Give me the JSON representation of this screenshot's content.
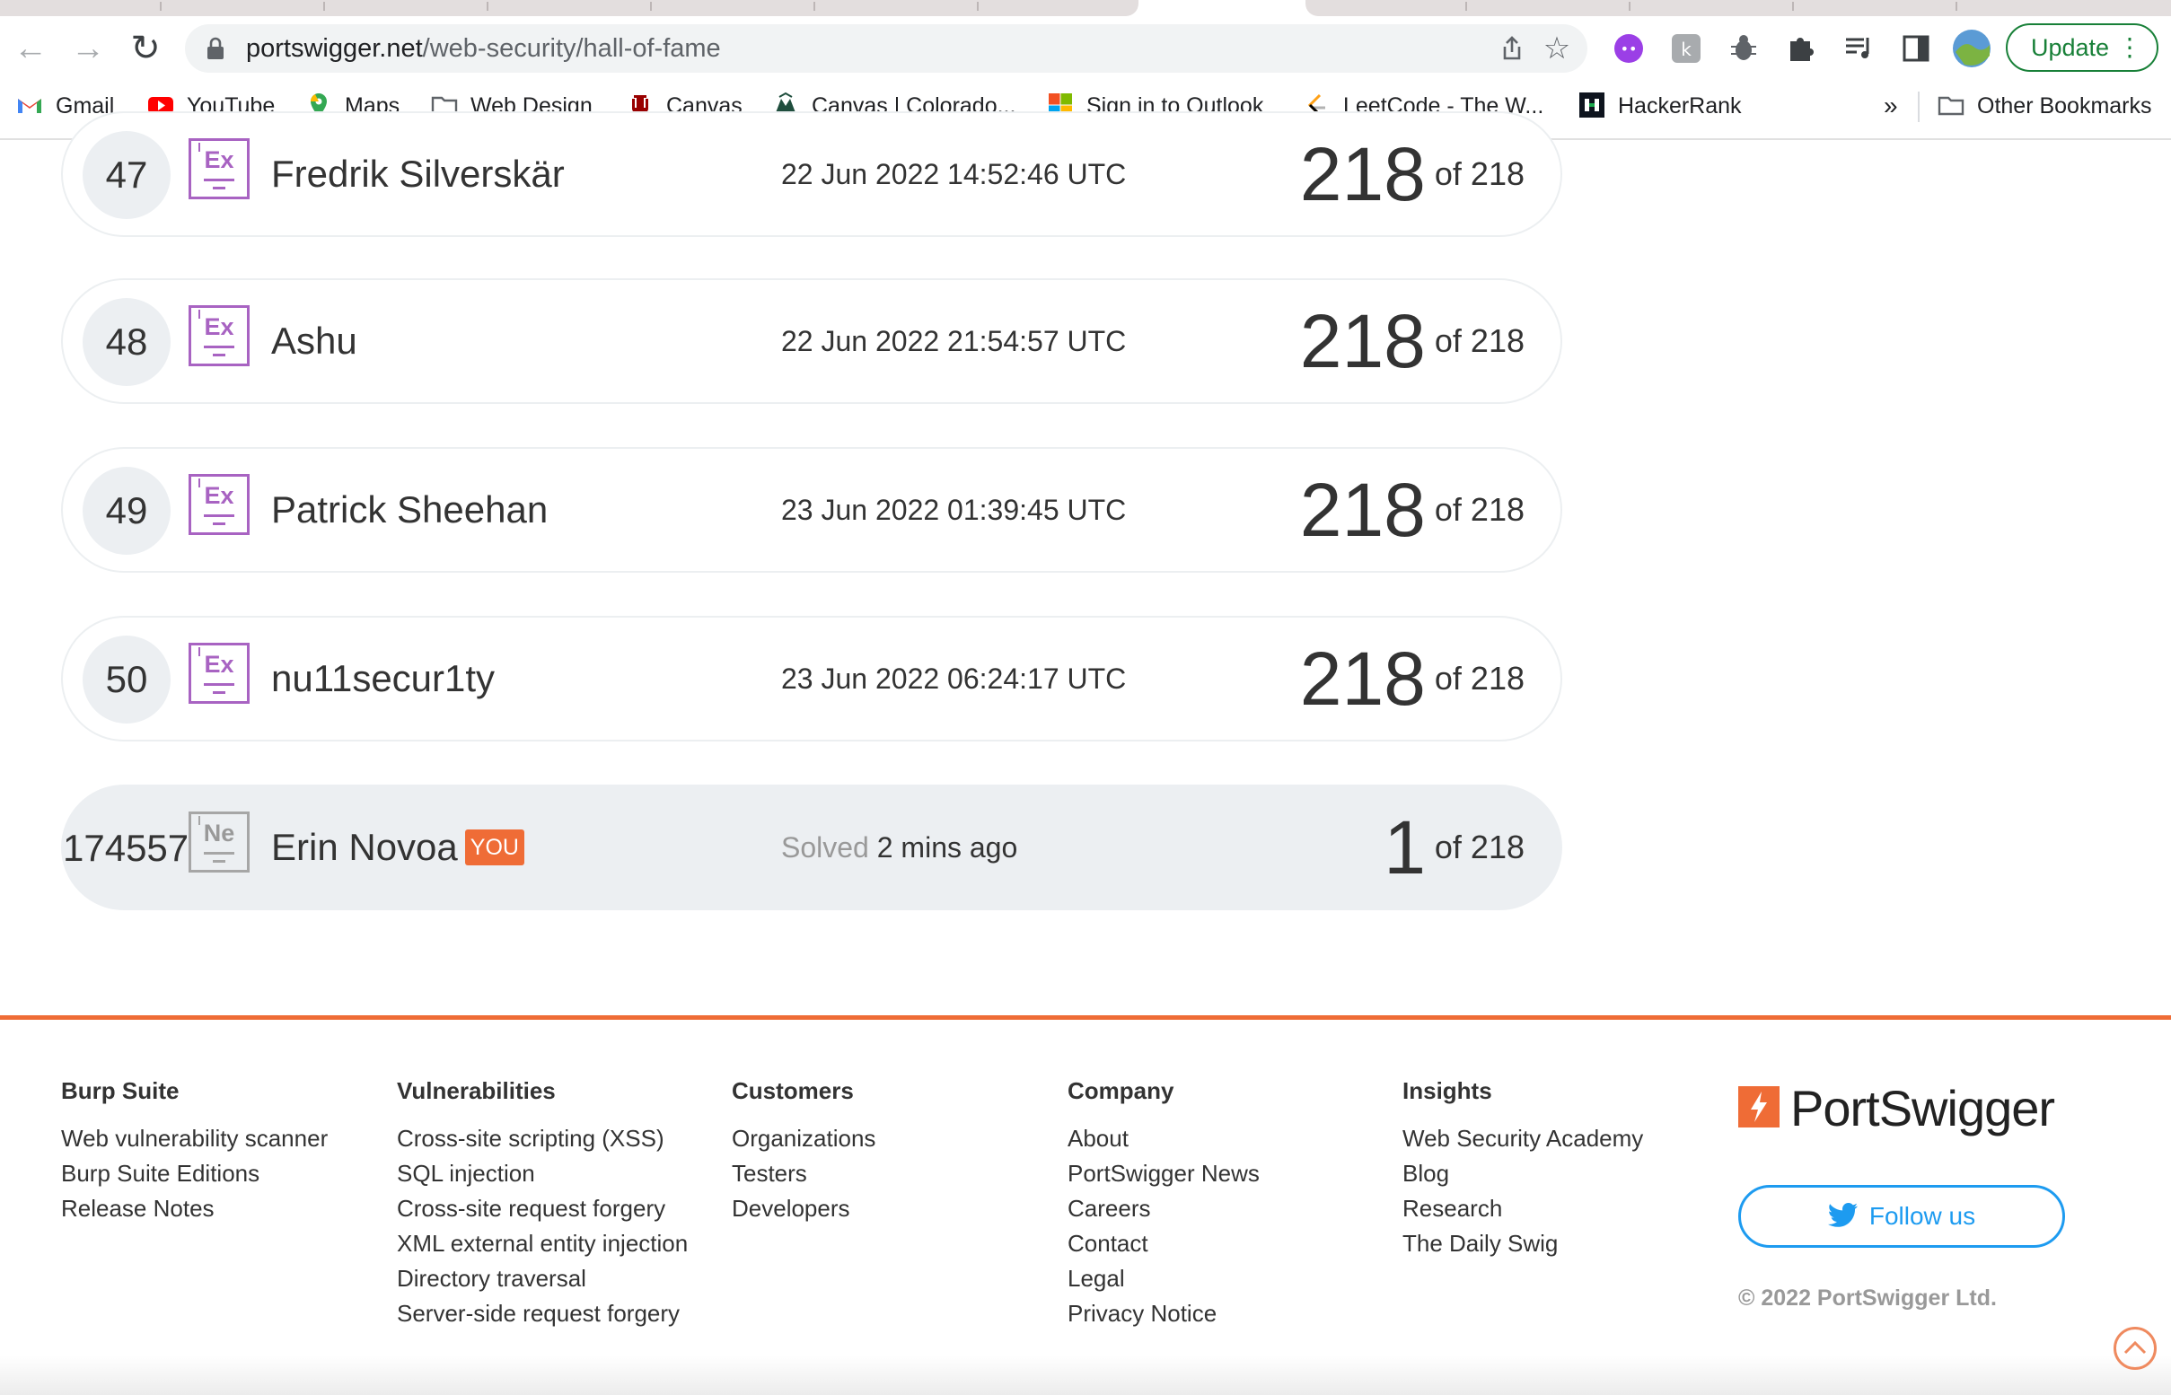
{
  "browser": {
    "url_host": "portswigger.net",
    "url_path": "/web-security/hall-of-fame",
    "update_label": "Update",
    "bookmarks": [
      {
        "label": "Gmail",
        "icon": "gmail-icon"
      },
      {
        "label": "YouTube",
        "icon": "youtube-icon"
      },
      {
        "label": "Maps",
        "icon": "maps-icon"
      },
      {
        "label": "Web Design",
        "icon": "folder-icon"
      },
      {
        "label": "Canvas",
        "icon": "canvas-iu-icon"
      },
      {
        "label": "Canvas | Colorado...",
        "icon": "canvas-colorado-icon"
      },
      {
        "label": "Sign in to Outlook",
        "icon": "microsoft-icon"
      },
      {
        "label": "LeetCode - The W...",
        "icon": "leetcode-icon"
      },
      {
        "label": "HackerRank",
        "icon": "hackerrank-icon"
      }
    ],
    "overflow_label": "»",
    "other_bookmarks": "Other Bookmarks"
  },
  "leaderboard": [
    {
      "rank": "47",
      "badge": "Ex",
      "name": "Fredrik Silverskär",
      "time": "22 Jun 2022 14:52:46 UTC",
      "score": "218",
      "total": "of 218"
    },
    {
      "rank": "48",
      "badge": "Ex",
      "name": "Ashu",
      "time": "22 Jun 2022 21:54:57 UTC",
      "score": "218",
      "total": "of 218"
    },
    {
      "rank": "49",
      "badge": "Ex",
      "name": "Patrick Sheehan",
      "time": "23 Jun 2022 01:39:45 UTC",
      "score": "218",
      "total": "of 218"
    },
    {
      "rank": "50",
      "badge": "Ex",
      "name": "nu11secur1ty",
      "time": "23 Jun 2022 06:24:17 UTC",
      "score": "218",
      "total": "of 218"
    }
  ],
  "you_row": {
    "rank": "174557",
    "badge": "Ne",
    "name": "Erin Novoa",
    "you_tag": "YOU",
    "solved_label": "Solved",
    "solved_when": "2 mins ago",
    "score": "1",
    "total": "of 218"
  },
  "footer": {
    "columns": [
      {
        "heading": "Burp Suite",
        "links": [
          "Web vulnerability scanner",
          "Burp Suite Editions",
          "Release Notes"
        ]
      },
      {
        "heading": "Vulnerabilities",
        "links": [
          "Cross-site scripting (XSS)",
          "SQL injection",
          "Cross-site request forgery",
          "XML external entity injection",
          "Directory traversal",
          "Server-side request forgery"
        ]
      },
      {
        "heading": "Customers",
        "links": [
          "Organizations",
          "Testers",
          "Developers"
        ]
      },
      {
        "heading": "Company",
        "links": [
          "About",
          "PortSwigger News",
          "Careers",
          "Contact",
          "Legal",
          "Privacy Notice"
        ]
      },
      {
        "heading": "Insights",
        "links": [
          "Web Security Academy",
          "Blog",
          "Research",
          "The Daily Swig"
        ]
      }
    ],
    "logo_text": "PortSwigger",
    "follow_label": "Follow us",
    "copyright": "© 2022 PortSwigger Ltd."
  },
  "colors": {
    "accent": "#ef6c36",
    "badge_expert": "#a863c2",
    "twitter": "#1d9bf0",
    "update_green": "#188038"
  }
}
